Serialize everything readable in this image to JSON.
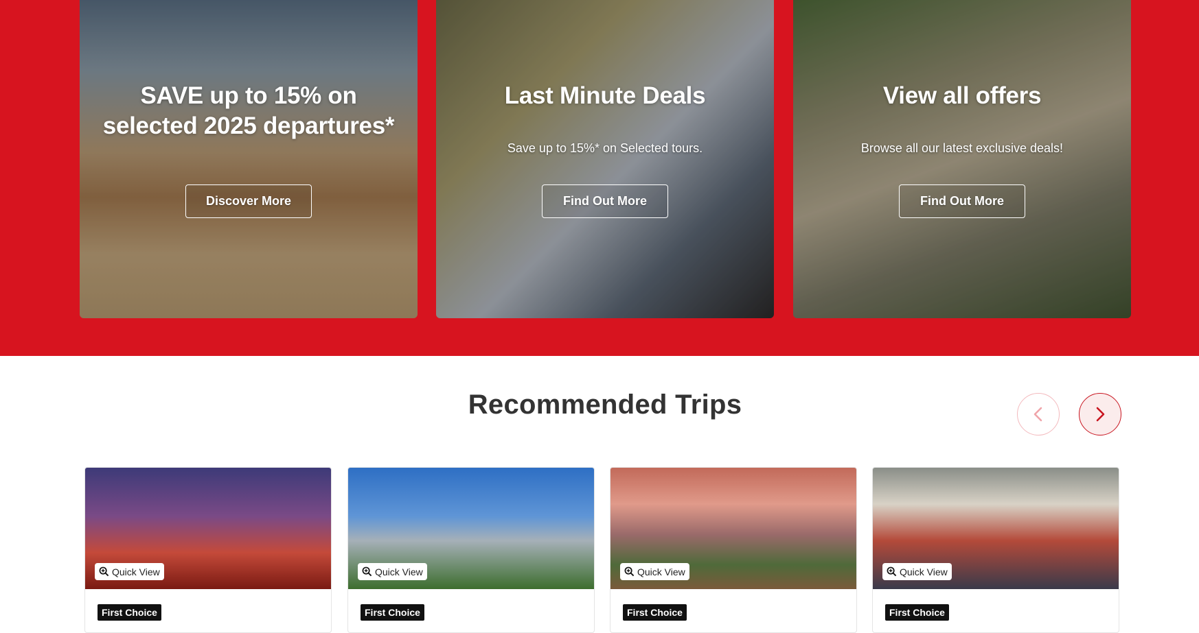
{
  "promos": [
    {
      "title": "SAVE up to 15% on selected 2025 departures*",
      "subtitle": "",
      "button": "Discover More"
    },
    {
      "title": "Last Minute Deals",
      "subtitle": "Save up to 15%* on Selected tours.",
      "button": "Find Out More"
    },
    {
      "title": "View all offers",
      "subtitle": "Browse all our latest exclusive deals!",
      "button": "Find Out More"
    }
  ],
  "recommended": {
    "title": "Recommended Trips",
    "prev_icon": "chevron-left-icon",
    "next_icon": "chevron-right-icon",
    "trips": [
      {
        "quick_view": "Quick View",
        "badge": "First Choice"
      },
      {
        "quick_view": "Quick View",
        "badge": "First Choice"
      },
      {
        "quick_view": "Quick View",
        "badge": "First Choice"
      },
      {
        "quick_view": "Quick View",
        "badge": "First Choice"
      }
    ]
  },
  "colors": {
    "brand_red": "#d7141f",
    "text_dark": "#333333"
  }
}
